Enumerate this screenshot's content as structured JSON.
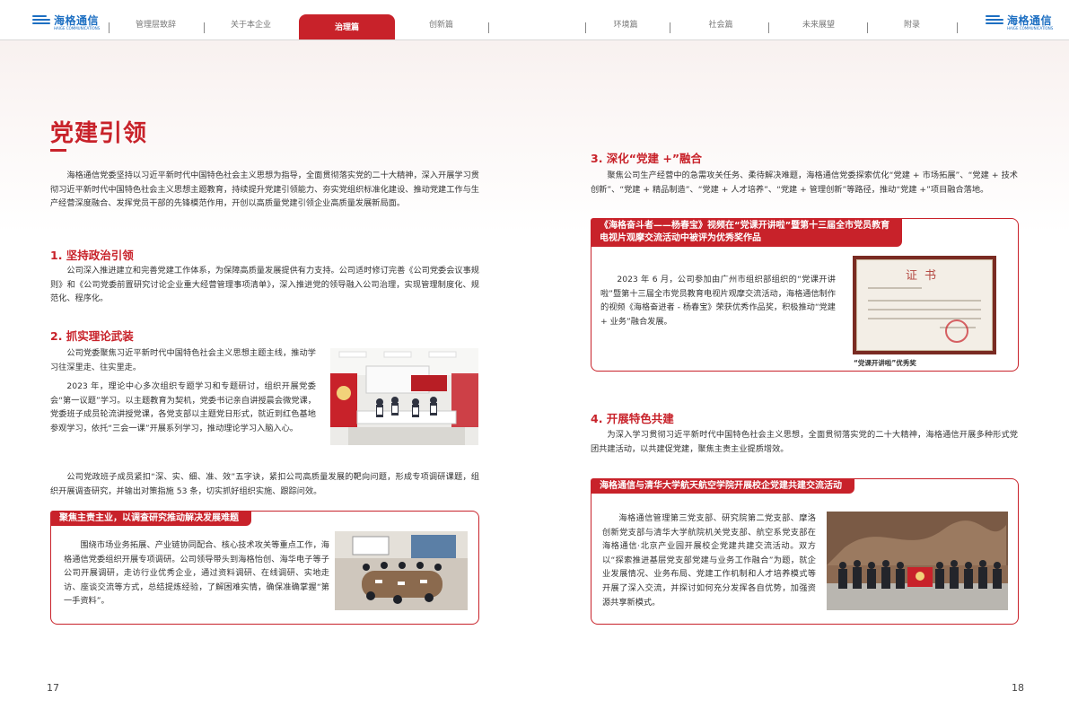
{
  "nav": {
    "logo_text": "海格通信",
    "logo_sub": "HAIGE COMMUNICATIONS",
    "items": [
      "管理层致辞",
      "关于本企业",
      "治理篇",
      "创新篇",
      "环境篇",
      "社会篇",
      "未来展望",
      "附录"
    ],
    "active_index": 2,
    "accent_color": "#c8222a"
  },
  "left": {
    "title": "党建引领",
    "intro": "海格通信党委坚持以习近平新时代中国特色社会主义思想为指导，全面贯彻落实党的二十大精神，深入开展学习贯彻习近平新时代中国特色社会主义思想主题教育，持续提升党建引领能力、夯实党组织标准化建设、推动党建工作与生产经营深度融合、发挥党员干部的先锋模范作用，开创以高质量党建引领企业高质量发展新局面。",
    "s1_title": "1. 坚持政治引领",
    "s1_text": "公司深入推进建立和完善党建工作体系，为保障高质量发展提供有力支持。公司适时修订完善《公司党委会议事规则》和《公司党委前置研究讨论企业重大经营管理事项清单》，深入推进党的领导融入公司治理，实现管理制度化、规范化、程序化。",
    "s2_title": "2. 抓实理论武装",
    "s2_p1": "公司党委聚焦习近平新时代中国特色社会主义思想主题主线，推动学习往深里走、往实里走。",
    "s2_p2": "2023 年，理论中心多次组织专题学习和专题研讨，组织开展党委会“第一议题”学习。以主题教育为契机，党委书记亲自讲授晨会微党课，党委班子成员轮流讲授党课，各党支部以主题党日形式，就近到红色基地参观学习，依托“三会一课”开展系列学习，推动理论学习入脑入心。",
    "s2_p3": "公司党政班子成员紧扣“深、实、细、准、效”五字诀，紧扣公司高质量发展的靶向问题，形成专项调研课题，组织开展调查研究，并输出对策指施 53 条，切实抓好组织实施、跟踪问效。",
    "box1_tag": "聚焦主责主业，以调查研究推动解决发展难题",
    "box1_text": "围绕市场业务拓展、产业链协同配合、核心技术攻关等重点工作，海格通信党委组织开展专项调研。公司领导带头到海格怡创、海华电子等子公司开展调研，走访行业优秀企业，通过资料调研、在线调研、实地走访、座谈交流等方式，总结提炼经验，了解困难实情，确保准确掌握“第一手资料”。",
    "page": "17"
  },
  "right": {
    "s3_title": "3. 深化“党建 +”融合",
    "s3_text": "聚焦公司生产经营中的急需攻关任务、柔待解决难题，海格通信党委探索优化“党建 + 市场拓展”、“党建 + 技术创新”、“党建 + 精品制造”、“党建 + 人才培养”、“党建 + 管理创新”等路径，推动“党建 +”项目融合落地。",
    "box2_tag_line1": "《海格奋斗者——杨春宝》视频在“党课开讲啦”暨第十三届全市党员教育",
    "box2_tag_line2": "电视片观摩交流活动中被评为优秀奖作品",
    "box2_text": "2023 年 6 月，公司参加由广州市组织部组织的“党课开讲啦”暨第十三届全市党员教育电视片观摩交流活动，海格通信制作的视频《海格奋进者 - 杨春宝》荣获优秀作品奖，积极推动“党建 + 业务”融合发展。",
    "cert_title": "证书",
    "cert_caption": "“党课开讲啦”优秀奖",
    "s4_title": "4. 开展特色共建",
    "s4_text": "为深入学习贯彻习近平新时代中国特色社会主义思想，全面贯彻落实党的二十大精神，海格通信开展多种形式党团共建活动，以共建促党建，聚焦主责主业提质增效。",
    "box3_tag": "海格通信与清华大学航天航空学院开展校企党建共建交流活动",
    "box3_text": "海格通信管理第三党支部、研究院第二党支部、摩洛创新党支部与清华大学航院机关党支部、航空系党支部在海格通信·北京产业园开展校企党建共建交流活动。双方以“探索推进基层党支部党建与业务工作融合”为题，就企业发展情况、业务布局、党建工作机制和人才培养模式等开展了深入交流，并探讨如何充分发挥各自优势，加强资源共享新模式。",
    "page": "18"
  }
}
